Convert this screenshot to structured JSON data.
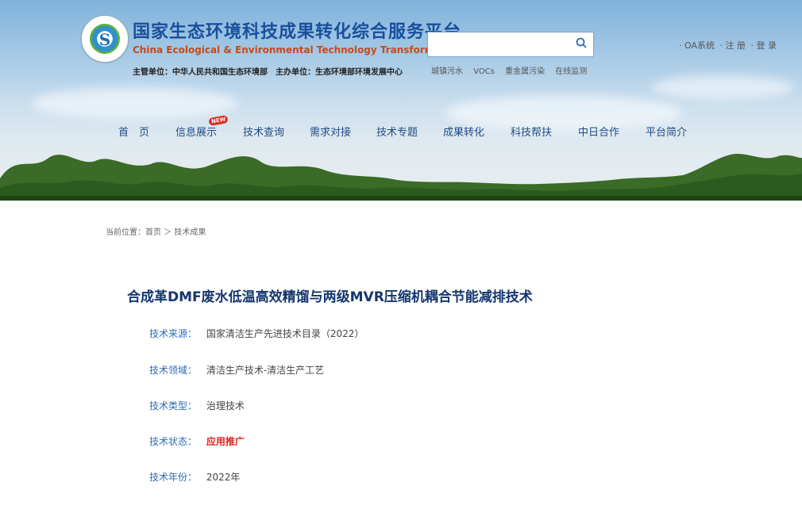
{
  "header": {
    "title": "国家生态环境科技成果转化综合服务平台",
    "title_en": "China Ecological & Environmental Technology Transformation",
    "subtitle": "主管单位：中华人民共和国生态环境部　主办单位：生态环境部环境发展中心",
    "search": {
      "value": "",
      "placeholder": ""
    },
    "hot_links": [
      "城镇污水",
      "VOCs",
      "重金属污染",
      "在线监测"
    ],
    "top_links": [
      "· OA系统",
      "· 注 册",
      "· 登 录"
    ],
    "new_badge": "NEW"
  },
  "nav": {
    "items": [
      "首　页",
      "信息展示",
      "技术查询",
      "需求对接",
      "技术专题",
      "成果转化",
      "科技帮扶",
      "中日合作",
      "平台简介"
    ]
  },
  "breadcrumb": "当前位置：首页 ＞ 技术成果",
  "article": {
    "title": "合成革DMF废水低温高效精馏与两级MVR压缩机耦合节能减排技术",
    "fields": [
      {
        "label": "技术来源：",
        "value": "国家清洁生产先进技术目录（2022）"
      },
      {
        "label": "技术领域：",
        "value": "清洁生产技术-清洁生产工艺"
      },
      {
        "label": "技术类型：",
        "value": "治理技术"
      },
      {
        "label": "技术状态：",
        "value": "应用推广"
      },
      {
        "label": "技术年份：",
        "value": "2022年"
      }
    ]
  },
  "colors": {
    "nav_text": "#1f4c86",
    "title_blue": "#1a4f9c",
    "label_blue": "#2f6bb8",
    "status_red": "#e0251a"
  }
}
